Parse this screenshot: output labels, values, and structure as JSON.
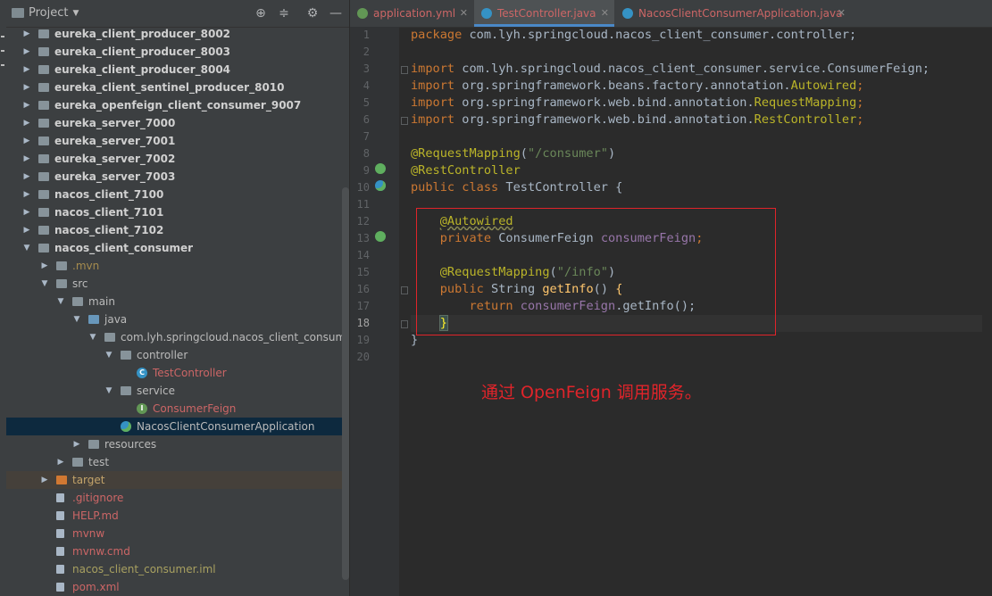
{
  "project_panel": {
    "title": "Project",
    "tree": [
      {
        "label": "eureka_client_producer_8002",
        "depth": 0,
        "kind": "module",
        "arrow": "right",
        "bold": true
      },
      {
        "label": "eureka_client_producer_8003",
        "depth": 0,
        "kind": "module",
        "arrow": "right",
        "bold": true
      },
      {
        "label": "eureka_client_producer_8004",
        "depth": 0,
        "kind": "module",
        "arrow": "right",
        "bold": true
      },
      {
        "label": "eureka_client_sentinel_producer_8010",
        "depth": 0,
        "kind": "module",
        "arrow": "right",
        "bold": true
      },
      {
        "label": "eureka_openfeign_client_consumer_9007",
        "depth": 0,
        "kind": "module",
        "arrow": "right",
        "bold": true
      },
      {
        "label": "eureka_server_7000",
        "depth": 0,
        "kind": "module",
        "arrow": "right",
        "bold": true
      },
      {
        "label": "eureka_server_7001",
        "depth": 0,
        "kind": "module",
        "arrow": "right",
        "bold": true
      },
      {
        "label": "eureka_server_7002",
        "depth": 0,
        "kind": "module",
        "arrow": "right",
        "bold": true
      },
      {
        "label": "eureka_server_7003",
        "depth": 0,
        "kind": "module",
        "arrow": "right",
        "bold": true
      },
      {
        "label": "nacos_client_7100",
        "depth": 0,
        "kind": "module",
        "arrow": "right",
        "bold": true
      },
      {
        "label": "nacos_client_7101",
        "depth": 0,
        "kind": "module",
        "arrow": "right",
        "bold": true
      },
      {
        "label": "nacos_client_7102",
        "depth": 0,
        "kind": "module",
        "arrow": "right",
        "bold": true
      },
      {
        "label": "nacos_client_consumer",
        "depth": 0,
        "kind": "module",
        "arrow": "down",
        "bold": true
      },
      {
        "label": ".mvn",
        "depth": 1,
        "kind": "folder",
        "arrow": "right",
        "color": "mvn"
      },
      {
        "label": "src",
        "depth": 1,
        "kind": "folder",
        "arrow": "down"
      },
      {
        "label": "main",
        "depth": 2,
        "kind": "folder",
        "arrow": "down"
      },
      {
        "label": "java",
        "depth": 3,
        "kind": "folder-blue",
        "arrow": "down"
      },
      {
        "label": "com.lyh.springcloud.nacos_client_consumer",
        "depth": 4,
        "kind": "package",
        "arrow": "down"
      },
      {
        "label": "controller",
        "depth": 5,
        "kind": "package",
        "arrow": "down"
      },
      {
        "label": "TestController",
        "depth": 6,
        "kind": "class",
        "arrow": "",
        "color": "red"
      },
      {
        "label": "service",
        "depth": 5,
        "kind": "package",
        "arrow": "down"
      },
      {
        "label": "ConsumerFeign",
        "depth": 6,
        "kind": "interface",
        "arrow": "",
        "color": "red"
      },
      {
        "label": "NacosClientConsumerApplication",
        "depth": 5,
        "kind": "app",
        "arrow": "",
        "selected": true
      },
      {
        "label": "resources",
        "depth": 3,
        "kind": "folder",
        "arrow": "right"
      },
      {
        "label": "test",
        "depth": 2,
        "kind": "folder",
        "arrow": "right"
      },
      {
        "label": "target",
        "depth": 1,
        "kind": "folder-orange",
        "arrow": "right",
        "color": "orange",
        "excluded": true
      },
      {
        "label": ".gitignore",
        "depth": 1,
        "kind": "file",
        "arrow": "",
        "color": "red"
      },
      {
        "label": "HELP.md",
        "depth": 1,
        "kind": "file",
        "arrow": "",
        "color": "red"
      },
      {
        "label": "mvnw",
        "depth": 1,
        "kind": "file",
        "arrow": "",
        "color": "red"
      },
      {
        "label": "mvnw.cmd",
        "depth": 1,
        "kind": "file",
        "arrow": "",
        "color": "red"
      },
      {
        "label": "nacos_client_consumer.iml",
        "depth": 1,
        "kind": "file",
        "arrow": "",
        "color": "olive"
      },
      {
        "label": "pom.xml",
        "depth": 1,
        "kind": "file",
        "arrow": "",
        "color": "red"
      }
    ]
  },
  "tabs": [
    {
      "label": "application.yml",
      "icon": "yaml-icon",
      "active": false
    },
    {
      "label": "TestController.java",
      "icon": "class-icon",
      "active": true
    },
    {
      "label": "NacosClientConsumerApplication.java",
      "icon": "app-icon",
      "active": false
    }
  ],
  "editor": {
    "current_line": 18,
    "line_numbers": [
      "1",
      "2",
      "3",
      "4",
      "5",
      "6",
      "7",
      "8",
      "9",
      "10",
      "11",
      "12",
      "13",
      "14",
      "15",
      "16",
      "17",
      "18",
      "19",
      "20"
    ],
    "code": {
      "l1": [
        "package",
        " com.lyh.springcloud.nacos_client_consumer.controller;"
      ],
      "l3": [
        "import",
        " com.lyh.springcloud.nacos_client_consumer.service.ConsumerFeign;"
      ],
      "l4": [
        "import",
        " org.springframework.beans.factory.annotation.",
        "Autowired",
        ";"
      ],
      "l5": [
        "import",
        " org.springframework.web.bind.annotation.",
        "RequestMapping",
        ";"
      ],
      "l6": [
        "import",
        " org.springframework.web.bind.annotation.",
        "RestController",
        ";"
      ],
      "l8": [
        "@RequestMapping",
        "(",
        "\"/consumer\"",
        ")"
      ],
      "l9": [
        "@RestController"
      ],
      "l10": [
        "public class",
        " TestController {"
      ],
      "l12": [
        "@Autowired"
      ],
      "l13": [
        "private",
        " ConsumerFeign ",
        "consumerFeign",
        ";"
      ],
      "l15": [
        "@RequestMapping",
        "(",
        "\"/info\"",
        ")"
      ],
      "l16": [
        "public",
        " String ",
        "getInfo",
        "() ",
        "{"
      ],
      "l17": [
        "return",
        " ",
        "consumerFeign",
        ".getInfo();"
      ],
      "l18": [
        "}"
      ],
      "l19": [
        "}"
      ]
    }
  },
  "annotation_note": "通过 OpenFeign 调用服务。",
  "colors": {
    "keyword": "#cc7832",
    "annotation": "#bbb529",
    "string": "#6a8759",
    "field": "#9876aa",
    "method": "#ffc66d",
    "highlight_box": "#e0242a"
  }
}
